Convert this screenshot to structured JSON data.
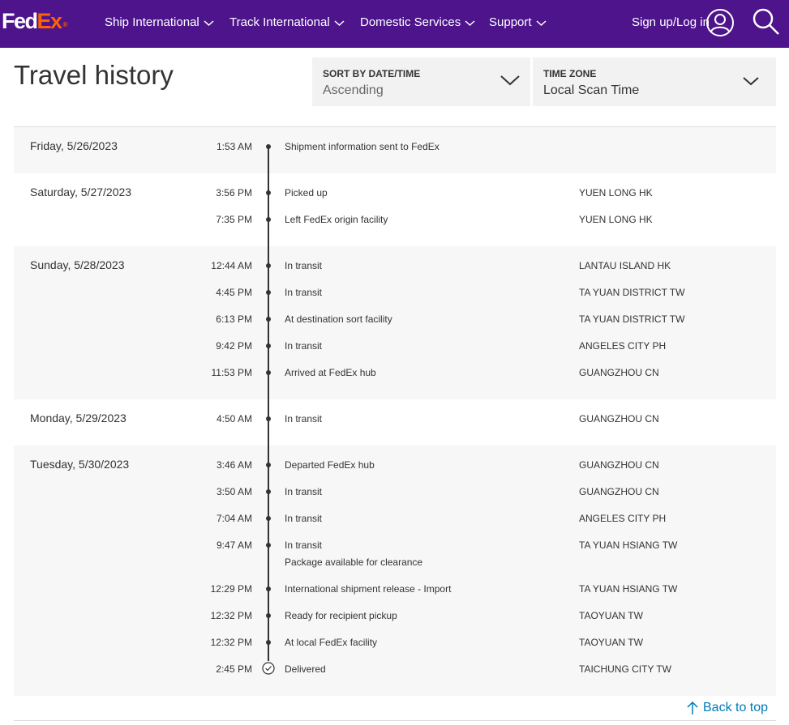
{
  "header": {
    "logo_fed": "Fed",
    "logo_ex": "Ex",
    "logo_reg": "®",
    "nav": [
      {
        "label": "Ship International"
      },
      {
        "label": "Track International"
      },
      {
        "label": "Domestic Services"
      },
      {
        "label": "Support"
      }
    ],
    "signin_label": "Sign up/Log in",
    "icons": {
      "user": "user-circle-icon",
      "search": "search-icon",
      "nav_chevron": "chevron-down-icon"
    }
  },
  "page": {
    "title": "Travel history",
    "sort": {
      "label": "SORT BY DATE/TIME",
      "value": "Ascending"
    },
    "timezone": {
      "label": "TIME ZONE",
      "value": "Local Scan Time"
    },
    "back_to_top": "Back to top"
  },
  "days": [
    {
      "date": "Friday, 5/26/2023",
      "events": [
        {
          "time": "1:53 AM",
          "desc": "Shipment information sent to FedEx",
          "location": ""
        }
      ]
    },
    {
      "date": "Saturday, 5/27/2023",
      "events": [
        {
          "time": "3:56 PM",
          "desc": "Picked up",
          "location": "YUEN LONG HK"
        },
        {
          "time": "7:35 PM",
          "desc": "Left FedEx origin facility",
          "location": "YUEN LONG HK"
        }
      ]
    },
    {
      "date": "Sunday, 5/28/2023",
      "events": [
        {
          "time": "12:44 AM",
          "desc": "In transit",
          "location": "LANTAU ISLAND HK"
        },
        {
          "time": "4:45 PM",
          "desc": "In transit",
          "location": "TA YUAN DISTRICT TW"
        },
        {
          "time": "6:13 PM",
          "desc": "At destination sort facility",
          "location": "TA YUAN DISTRICT TW"
        },
        {
          "time": "9:42 PM",
          "desc": "In transit",
          "location": "ANGELES CITY PH"
        },
        {
          "time": "11:53 PM",
          "desc": "Arrived at FedEx hub",
          "location": "GUANGZHOU CN"
        }
      ]
    },
    {
      "date": "Monday, 5/29/2023",
      "events": [
        {
          "time": "4:50 AM",
          "desc": "In transit",
          "location": "GUANGZHOU CN"
        }
      ]
    },
    {
      "date": "Tuesday, 5/30/2023",
      "events": [
        {
          "time": "3:46 AM",
          "desc": "Departed FedEx hub",
          "location": "GUANGZHOU CN"
        },
        {
          "time": "3:50 AM",
          "desc": "In transit",
          "location": "GUANGZHOU CN"
        },
        {
          "time": "7:04 AM",
          "desc": "In transit",
          "location": "ANGELES CITY PH"
        },
        {
          "time": "9:47 AM",
          "desc": "In transit",
          "note": "Package available for clearance",
          "location": "TA YUAN HSIANG TW"
        },
        {
          "time": "12:29 PM",
          "desc": "International shipment release - Import",
          "location": "TA YUAN HSIANG TW"
        },
        {
          "time": "12:32 PM",
          "desc": "Ready for recipient pickup",
          "location": "TAOYUAN TW"
        },
        {
          "time": "12:32 PM",
          "desc": "At local FedEx facility",
          "location": "TAOYUAN TW"
        },
        {
          "time": "2:45 PM",
          "desc": "Delivered",
          "location": "TAICHUNG CITY TW",
          "delivered": true
        }
      ]
    }
  ]
}
